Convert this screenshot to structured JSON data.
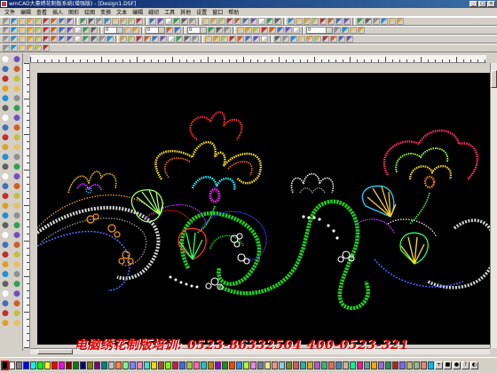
{
  "window": {
    "title": "wmCAD大豪绣花制版系统(增强版) - [Design1.DSF]",
    "buttons": [
      "_",
      "□",
      "×"
    ]
  },
  "menu": {
    "items": [
      "文件",
      "编辑",
      "查看",
      "插入",
      "图形",
      "绘图",
      "变换",
      "文本",
      "编辑",
      "缝纫",
      "工具",
      "其他",
      "设置",
      "窗口",
      "帮助"
    ]
  },
  "toolbar_combos": {
    "width_1": "0",
    "width_2": "0",
    "width_3": "0",
    "zoom": "0"
  },
  "watermark": {
    "text": "电脑绣花制版培训: 0523-86332504  400-0523-321"
  },
  "colors": {
    "canvas_background": "#000000",
    "window_background": "#d4d0c8",
    "title_bar": "#0a246a",
    "watermark": "#e00000"
  },
  "palette": {
    "swatches": [
      "#000000",
      "#ffffff",
      "#808080",
      "#0000ff",
      "#00ffff",
      "#00ff00",
      "#ffff00",
      "#ff0000",
      "#ff00ff",
      "#800000",
      "#008000",
      "#000080",
      "#808000",
      "#800080",
      "#008080",
      "#c0c0c0",
      "#ff8040",
      "#80ff80",
      "#8080ff",
      "#ff80c0",
      "#40e0d0",
      "#ffd700",
      "#a0522d",
      "#7fff00",
      "#dc143c",
      "#4169e1",
      "#9acd32",
      "#ff69b4",
      "#00ced1",
      "#b8860b",
      "#9400d3",
      "#228b22",
      "#ff4500",
      "#1e90ff",
      "#adff2f",
      "#ee82ee",
      "#708090",
      "#f0e68c",
      "#e9967a",
      "#87ceeb",
      "#6b8e23",
      "#cd5c5c",
      "#20b2aa",
      "#daa520",
      "#ba55d3",
      "#3cb371",
      "#ff6347",
      "#4682b4",
      "#d2b48c",
      "#00fa9a",
      "#ff1493",
      "#5f9ea0",
      "#ffa500",
      "#9370db",
      "#2e8b57",
      "#b22222",
      "#7b68ee",
      "#bdb76b",
      "#8fbc8f",
      "#fa8072",
      "#00bfff"
    ],
    "selected_index": 0,
    "right_icons": [
      "+",
      "■",
      "●",
      "?",
      "◐"
    ]
  },
  "icons": [
    "new-file-icon",
    "open-icon",
    "save-icon",
    "print-icon",
    "cut-icon",
    "copy-icon",
    "paste-icon",
    "undo-icon",
    "redo-icon",
    "zoom-in-icon",
    "zoom-out-icon",
    "select-icon",
    "pen-icon",
    "rectangle-icon",
    "ellipse-icon",
    "text-icon",
    "fill-icon",
    "stitch-icon"
  ]
}
